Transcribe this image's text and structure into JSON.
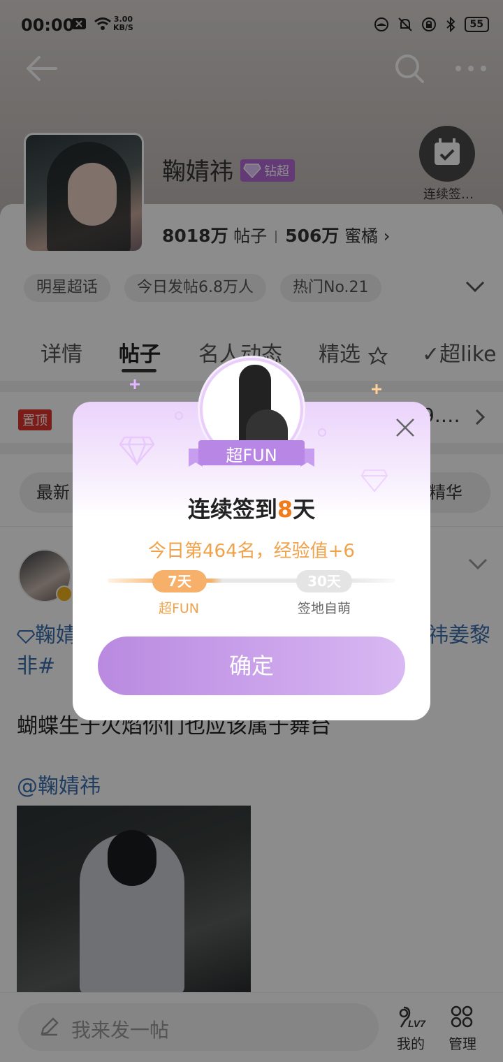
{
  "status_bar": {
    "time": "00:00",
    "speed_value": "3.00",
    "speed_unit": "KB/S",
    "battery": "55"
  },
  "profile": {
    "name": "鞠婧祎",
    "badge_label": "钻超",
    "posts_count": "8018万",
    "posts_label": "帖子",
    "fans_count": "506万",
    "fans_label": "蜜橘",
    "checkin_label": "连续签…"
  },
  "tags": [
    "明星超话",
    "今日发帖6.8万人",
    "热门No.21"
  ],
  "tabs": [
    "详情",
    "帖子",
    "名人动态",
    "精选",
    "✓超like"
  ],
  "pinned": {
    "tag": "置顶",
    "text_tail": "9.…"
  },
  "sort": {
    "left": "最新",
    "right": "精华"
  },
  "post": {
    "line1_start": "鞠婧",
    "line1_end": "祎姜黎",
    "line2": "非#",
    "body": "蝴蝶生于火焰你们也应该属于舞台",
    "mention": "@鞠婧祎"
  },
  "bottom_bar": {
    "compose_placeholder": "我来发一帖",
    "mine_level": "LV7",
    "mine_label": "我的",
    "manage_label": "管理"
  },
  "modal": {
    "ribbon": "超FUN",
    "title_prefix": "连续签到",
    "title_days": "8",
    "title_suffix": "天",
    "subtitle": "今日第464名，经验值+6",
    "milestone_1_days": "7天",
    "milestone_1_label": "超FUN",
    "milestone_2_days": "30天",
    "milestone_2_label": "签地自萌",
    "confirm": "确定"
  },
  "colors": {
    "accent_purple": "#c9a0ea",
    "accent_orange": "#f07d1a",
    "link_blue": "#3b6fb0"
  }
}
